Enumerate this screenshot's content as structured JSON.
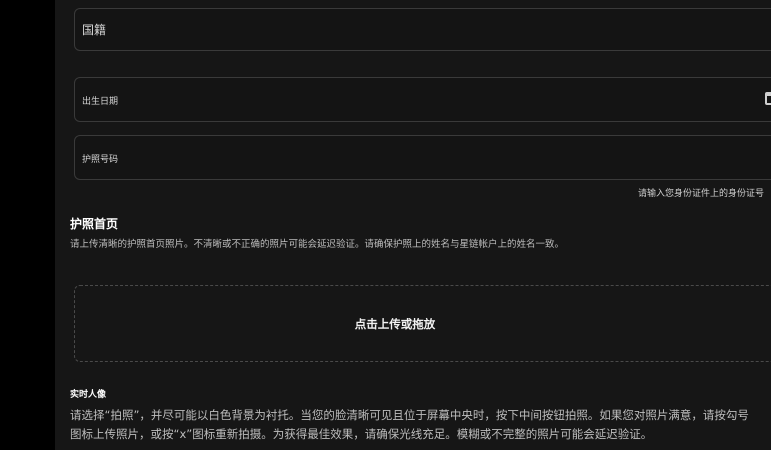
{
  "form": {
    "nationality_label": "国籍",
    "dob_label": "出生日期",
    "passport_number_label": "护照号码",
    "passport_number_helper": "请输入您身份证件上的身份证号"
  },
  "passport_front": {
    "title": "护照首页",
    "description": "请上传清晰的护照首页照片。不清晰或不正确的照片可能会延迟验证。请确保护照上的姓名与星链帐户上的姓名一致。",
    "upload_label": "点击上传或拖放"
  },
  "live_portrait": {
    "title": "实时人像",
    "description": "请选择“拍照”，并尽可能以白色背景为衬托。当您的脸清晰可见且位于屏幕中央时，按下中间按钮拍照。如果您对照片满意，请按勾号图标上传照片，或按“x”图标重新拍摄。为获得最佳效果，请确保光线充足。模糊或不完整的照片可能会延迟验证。"
  },
  "icons": {
    "calendar": "calendar-icon"
  }
}
